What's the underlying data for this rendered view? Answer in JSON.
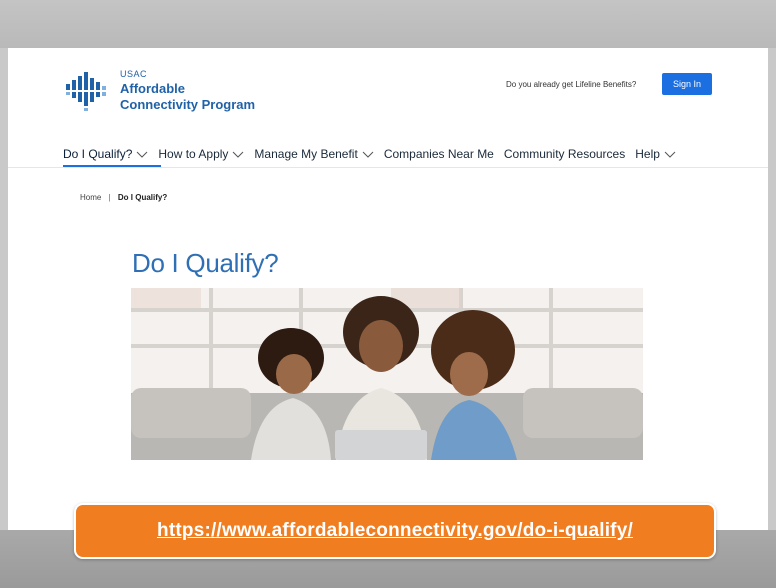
{
  "header": {
    "logo": {
      "org": "USAC",
      "name_line1": "Affordable",
      "name_line2": "Connectivity Program",
      "icon": "acp-logo-icon"
    },
    "lifeline_question": "Do you already get Lifeline Benefits?",
    "sign_in_label": "Sign In"
  },
  "nav": {
    "items": [
      {
        "label": "Do I Qualify?",
        "dropdown": true,
        "active": true
      },
      {
        "label": "How to Apply",
        "dropdown": true
      },
      {
        "label": "Manage My Benefit",
        "dropdown": true
      },
      {
        "label": "Companies Near Me",
        "dropdown": false
      },
      {
        "label": "Community Resources",
        "dropdown": false
      },
      {
        "label": "Help",
        "dropdown": true
      }
    ]
  },
  "breadcrumb": {
    "home": "Home",
    "separator": "|",
    "current": "Do I Qualify?"
  },
  "main": {
    "title": "Do I Qualify?",
    "hero_image": "family-on-couch-with-laptop-photo"
  },
  "banner": {
    "url_text": "https://www.affordableconnectivity.gov/do-i-qualify/"
  },
  "colors": {
    "brand_blue": "#1f62a8",
    "button_blue": "#1b6fe0",
    "title_blue": "#2f6fb5",
    "banner_orange": "#f07d1f"
  }
}
